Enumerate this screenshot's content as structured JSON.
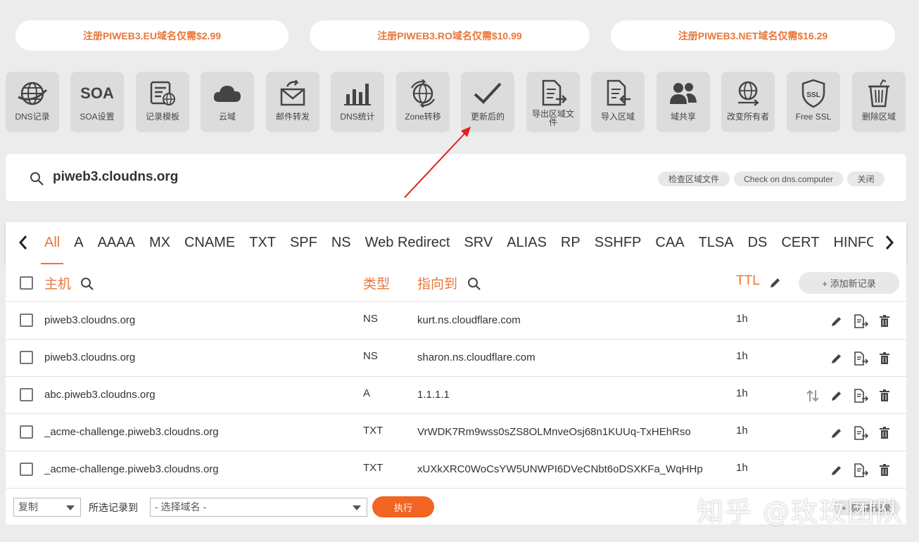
{
  "promos": [
    {
      "label": "注册PIWEB3.EU域名仅需$2.99"
    },
    {
      "label": "注册PIWEB3.RO域名仅需$10.99"
    },
    {
      "label": "注册PIWEB3.NET域名仅需$16.29"
    }
  ],
  "tools": [
    {
      "label": "DNS记录",
      "icon": "globe-icon"
    },
    {
      "label": "SOA设置",
      "icon": "soa-text-icon",
      "icon_text": "SOA"
    },
    {
      "label": "记录模板",
      "icon": "template-icon"
    },
    {
      "label": "云域",
      "icon": "cloud-icon"
    },
    {
      "label": "邮件转发",
      "icon": "mail-forward-icon"
    },
    {
      "label": "DNS统计",
      "icon": "bar-chart-icon"
    },
    {
      "label": "Zone转移",
      "icon": "globe-sync-icon"
    },
    {
      "label": "更新后的",
      "icon": "checkmark-icon"
    },
    {
      "label": "导出区域文件",
      "icon": "export-file-icon"
    },
    {
      "label": "导入区域",
      "icon": "import-file-icon"
    },
    {
      "label": "域共享",
      "icon": "users-icon"
    },
    {
      "label": "改变所有者",
      "icon": "globe-transfer-icon"
    },
    {
      "label": "Free SSL",
      "icon": "ssl-shield-icon",
      "icon_text": "SSL"
    },
    {
      "label": "删除区域",
      "icon": "trash-icon"
    }
  ],
  "zone": {
    "name": "piweb3.cloudns.org",
    "check_zone_label": "检查区域文件",
    "check_dns_label": "Check on dns.computer",
    "close_label": "关闭"
  },
  "tabs": [
    "All",
    "A",
    "AAAA",
    "MX",
    "CNAME",
    "TXT",
    "SPF",
    "NS",
    "Web Redirect",
    "SRV",
    "ALIAS",
    "RP",
    "SSHFP",
    "CAA",
    "TLSA",
    "DS",
    "CERT",
    "HINFO"
  ],
  "active_tab": "All",
  "table": {
    "headers": {
      "host": "主机",
      "type": "类型",
      "points_to": "指向到",
      "ttl": "TTL"
    },
    "add_record_label": "+ 添加新记录",
    "rows": [
      {
        "host": "piweb3.cloudns.org",
        "type": "NS",
        "points_to": "kurt.ns.cloudflare.com",
        "ttl": "1h"
      },
      {
        "host": "piweb3.cloudns.org",
        "type": "NS",
        "points_to": "sharon.ns.cloudflare.com",
        "ttl": "1h"
      },
      {
        "host": "abc.piweb3.cloudns.org",
        "type": "A",
        "points_to": "1.1.1.1",
        "ttl": "1h"
      },
      {
        "host": "_acme-challenge.piweb3.cloudns.org",
        "type": "TXT",
        "points_to": "VrWDK7Rm9wss0sZS8OLMnveOsj68n1KUUq-TxHEhRso",
        "ttl": "1h"
      },
      {
        "host": "_acme-challenge.piweb3.cloudns.org",
        "type": "TXT",
        "points_to": "xUXkXRC0WoCsYW5UNWPI6DVeCNbt6oDSXKFa_WqHHp",
        "ttl": "1h"
      }
    ]
  },
  "footer": {
    "action_value": "复制",
    "selected_to_label": "所选记录到",
    "domain_placeholder": "- 选择域名 -",
    "execute_label": "执行",
    "add_record_label": "+ 添加新记录"
  },
  "watermark": "知乎 @玫玫团队",
  "colors": {
    "accent": "#e9773a",
    "button": "#f26522",
    "arrow": "#e02020"
  }
}
